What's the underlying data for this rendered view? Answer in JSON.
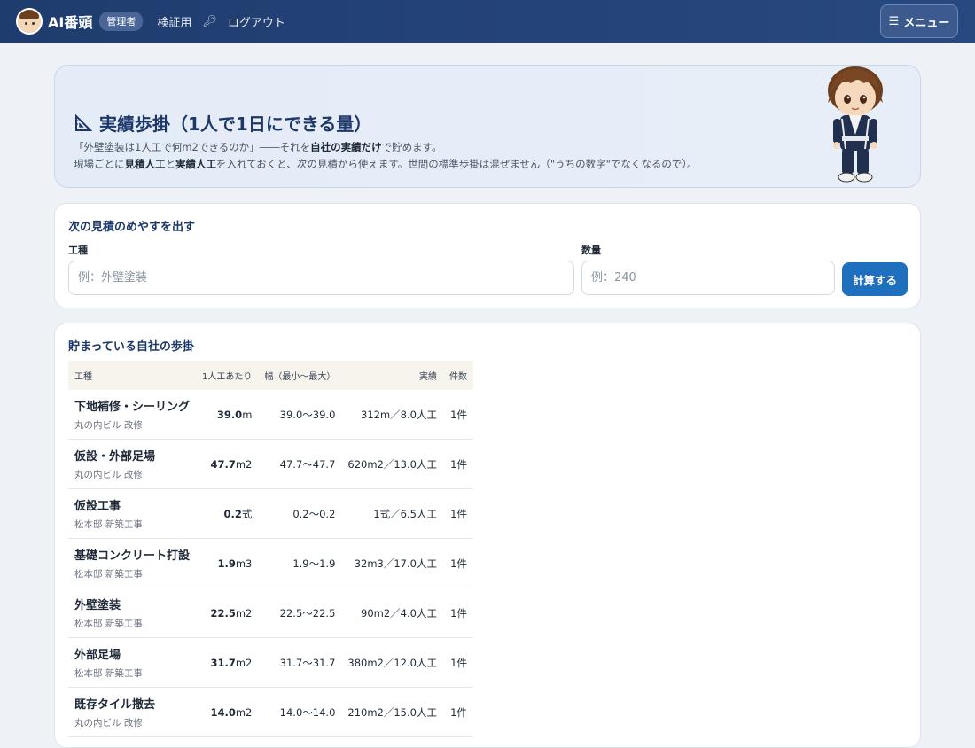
{
  "nav": {
    "brand": "AI番頭",
    "role_badge": "管理者",
    "link_verify": "検証用",
    "link_logout": "ログアウト",
    "menu_label": "メニュー"
  },
  "hero": {
    "title": "実績歩掛（1人で1日にできる量）",
    "line1_a": "「外壁塗装は1人工で何m2できるのか」――それを",
    "line1_b": "自社の実績だけ",
    "line1_c": "で貯めます。",
    "line2_a": "現場ごとに",
    "line2_b": "見積人工",
    "line2_c": "と",
    "line2_d": "実績人工",
    "line2_e": "を入れておくと、次の見積から使えます。世間の標準歩掛は混ぜません（\"うちの数字\"でなくなるので）。"
  },
  "calc": {
    "title": "次の見積のめやすを出す",
    "work_label": "工種",
    "work_placeholder": "例：外壁塗装",
    "qty_label": "数量",
    "qty_placeholder": "例：240",
    "button": "計算する"
  },
  "records": {
    "title": "貯まっている自社の歩掛",
    "columns": [
      "工種",
      "1人工あたり",
      "幅（最小〜最大）",
      "実績",
      "件数"
    ],
    "rows": [
      {
        "name": "下地補修・シーリング",
        "site": "丸の内ビル 改修",
        "rate": "39.0",
        "unit": "m",
        "range": "39.0〜39.0",
        "actual": "312m／8.0人工",
        "count": "1件"
      },
      {
        "name": "仮設・外部足場",
        "site": "丸の内ビル 改修",
        "rate": "47.7",
        "unit": "m2",
        "range": "47.7〜47.7",
        "actual": "620m2／13.0人工",
        "count": "1件"
      },
      {
        "name": "仮設工事",
        "site": "松本邸 新築工事",
        "rate": "0.2",
        "unit": "式",
        "range": "0.2〜0.2",
        "actual": "1式／6.5人工",
        "count": "1件"
      },
      {
        "name": "基礎コンクリート打設",
        "site": "松本邸 新築工事",
        "rate": "1.9",
        "unit": "m3",
        "range": "1.9〜1.9",
        "actual": "32m3／17.0人工",
        "count": "1件"
      },
      {
        "name": "外壁塗装",
        "site": "松本邸 新築工事",
        "rate": "22.5",
        "unit": "m2",
        "range": "22.5〜22.5",
        "actual": "90m2／4.0人工",
        "count": "1件"
      },
      {
        "name": "外部足場",
        "site": "松本邸 新築工事",
        "rate": "31.7",
        "unit": "m2",
        "range": "31.7〜31.7",
        "actual": "380m2／12.0人工",
        "count": "1件"
      },
      {
        "name": "既存タイル撤去",
        "site": "丸の内ビル 改修",
        "rate": "14.0",
        "unit": "m2",
        "range": "14.0〜14.0",
        "actual": "210m2／15.0人工",
        "count": "1件"
      }
    ]
  }
}
